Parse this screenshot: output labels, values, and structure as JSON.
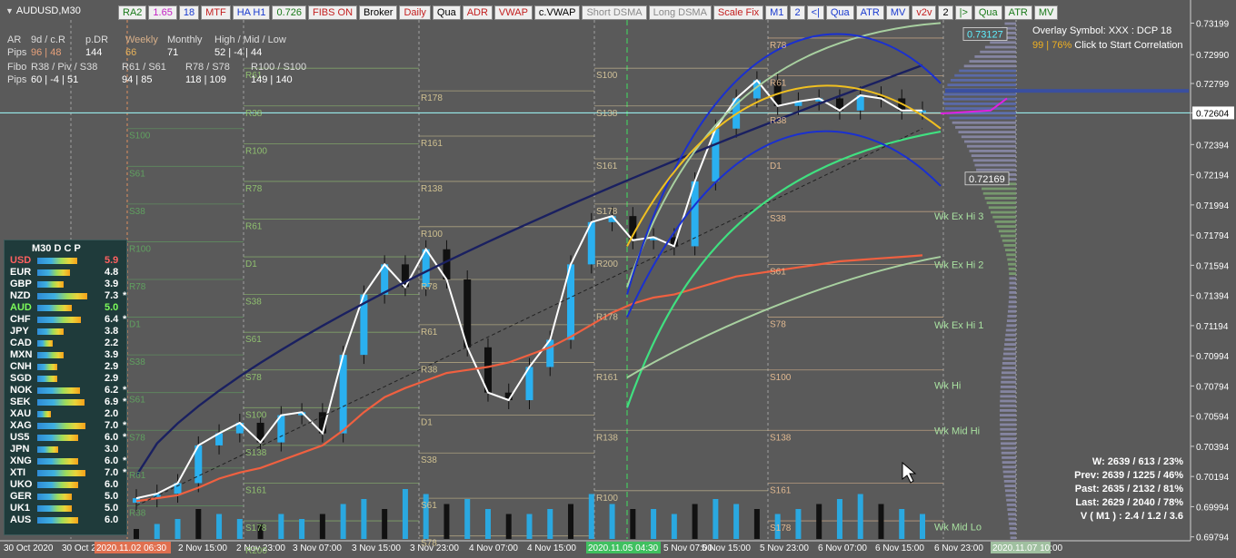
{
  "symbol": "AUDUSD,M30",
  "toolbar": [
    {
      "label": "RA2",
      "color": "#1a7a1a"
    },
    {
      "label": "1.65",
      "color": "#c41fc4"
    },
    {
      "label": "18",
      "color": "#1a3bd0"
    },
    {
      "label": "MTF",
      "color": "#c41f1f"
    },
    {
      "label": "HA H1",
      "color": "#1a3bd0"
    },
    {
      "label": "0.726",
      "color": "#1a7a1a"
    },
    {
      "label": "FIBS ON",
      "color": "#c41f1f"
    },
    {
      "label": "Broker",
      "color": "#000000"
    },
    {
      "label": "Daily",
      "color": "#c41f1f"
    },
    {
      "label": "Qua",
      "color": "#000000"
    },
    {
      "label": "ADR",
      "color": "#c41f1f"
    },
    {
      "label": "VWAP",
      "color": "#c41f1f"
    },
    {
      "label": "c.VWAP",
      "color": "#000000"
    },
    {
      "label": "Short DSMA",
      "color": "#8a8a8a"
    },
    {
      "label": "Long DSMA",
      "color": "#8a8a8a"
    },
    {
      "label": "Scale Fix",
      "color": "#c41f1f"
    },
    {
      "label": "M1",
      "color": "#1a3bd0"
    },
    {
      "label": "2",
      "color": "#1a3bd0"
    },
    {
      "label": "<|",
      "color": "#1a3bd0"
    },
    {
      "label": "Qua",
      "color": "#1a3bd0"
    },
    {
      "label": "ATR",
      "color": "#1a3bd0"
    },
    {
      "label": "MV",
      "color": "#1a3bd0"
    },
    {
      "label": "v2v",
      "color": "#c41f1f"
    },
    {
      "label": "2",
      "color": "#000000"
    },
    {
      "label": "|>",
      "color": "#1a7a1a"
    },
    {
      "label": "Qua",
      "color": "#1a7a1a"
    },
    {
      "label": "ATR",
      "color": "#1a7a1a"
    },
    {
      "label": "MV",
      "color": "#1a7a1a"
    }
  ],
  "info": {
    "row1": [
      "AR",
      "9d / c.R",
      "p.DR",
      "Weekly",
      "Monthly",
      "High / Mid / Low"
    ],
    "row2": [
      "Pips",
      "96 | 48",
      "144",
      "66",
      "71",
      "52 | -4 | 44"
    ],
    "row3": [
      "Fibo",
      "R38 / Piv / S38",
      "R61 / S61",
      "R78 / S78",
      "R100 / S100"
    ],
    "row4": [
      "Pips",
      "60 | -4 | 51",
      "94 | 85",
      "118 | 109",
      "149 | 140"
    ]
  },
  "overlay": {
    "line1": "Overlay Symbol: XXX : DCP 18",
    "line2_pct": "99 | 76%",
    "line2_rest": " Click to Start Correlation"
  },
  "price_boxes": {
    "top": "0.73127",
    "current": "0.72604",
    "mid": "0.72169"
  },
  "strength": {
    "header": "M30   D C P",
    "rows": [
      {
        "name": "USD",
        "value": "5.9",
        "star": "",
        "color": "#ff6060"
      },
      {
        "name": "EUR",
        "value": "4.8",
        "star": "",
        "color": "#ffffff"
      },
      {
        "name": "GBP",
        "value": "3.9",
        "star": "",
        "color": "#ffffff"
      },
      {
        "name": "NZD",
        "value": "7.3",
        "star": "*",
        "color": "#ffffff"
      },
      {
        "name": "AUD",
        "value": "5.0",
        "star": "",
        "color": "#7cfc5a"
      },
      {
        "name": "CHF",
        "value": "6.4",
        "star": "*",
        "color": "#ffffff"
      },
      {
        "name": "JPY",
        "value": "3.8",
        "star": "",
        "color": "#ffffff"
      },
      {
        "name": "CAD",
        "value": "2.2",
        "star": "",
        "color": "#ffffff"
      },
      {
        "name": "MXN",
        "value": "3.9",
        "star": "",
        "color": "#ffffff"
      },
      {
        "name": "CNH",
        "value": "2.9",
        "star": "",
        "color": "#ffffff"
      },
      {
        "name": "SGD",
        "value": "2.9",
        "star": "",
        "color": "#ffffff"
      },
      {
        "name": "NOK",
        "value": "6.2",
        "star": "*",
        "color": "#ffffff"
      },
      {
        "name": "SEK",
        "value": "6.9",
        "star": "*",
        "color": "#ffffff"
      },
      {
        "name": "XAU",
        "value": "2.0",
        "star": "",
        "color": "#ffffff"
      },
      {
        "name": "XAG",
        "value": "7.0",
        "star": "*",
        "color": "#ffffff"
      },
      {
        "name": "US5",
        "value": "6.0",
        "star": "*",
        "color": "#ffffff"
      },
      {
        "name": "JPN",
        "value": "3.0",
        "star": "",
        "color": "#ffffff"
      },
      {
        "name": "XNG",
        "value": "6.0",
        "star": "*",
        "color": "#ffffff"
      },
      {
        "name": "XTI",
        "value": "7.0",
        "star": "*",
        "color": "#ffffff"
      },
      {
        "name": "UKO",
        "value": "6.0",
        "star": "",
        "color": "#ffffff"
      },
      {
        "name": "GER",
        "value": "5.0",
        "star": "",
        "color": "#ffffff"
      },
      {
        "name": "UK1",
        "value": "5.0",
        "star": "",
        "color": "#ffffff"
      },
      {
        "name": "AUS",
        "value": "6.0",
        "star": "",
        "color": "#ffffff"
      }
    ]
  },
  "stats": [
    "W: 2639 / 613 / 23%",
    "Prev: 2639 / 1225 / 46%",
    "Past: 2635 / 2132 / 81%",
    "Last: 2629 / 2040 / 78%",
    "V ( M1 ) : 2.4 / 1.2 / 3.6"
  ],
  "side_labels": [
    "Wk Ex Hi 3",
    "Wk Ex Hi 2",
    "Wk Ex Hi 1",
    "Wk Hi",
    "Wk Mid Hi",
    "Wk Mid Lo"
  ],
  "fib_labels": [
    "R61",
    "R38",
    "R100",
    "R78",
    "R61",
    "D1",
    "S38",
    "S61",
    "S78",
    "S100",
    "S138",
    "S161",
    "S178",
    "R200",
    "R178",
    "R161",
    "R138",
    "R100",
    "R78",
    "R61",
    "R38",
    "D1",
    "S38",
    "S61",
    "S78",
    "S100",
    "S138",
    "S161",
    "S178",
    "R200",
    "R178",
    "R161",
    "R138",
    "R100",
    "R78",
    "R61",
    "R38",
    "D1",
    "S38",
    "S61",
    "S78",
    "S100",
    "S138",
    "S161",
    "S178",
    "S100",
    "S61",
    "S38",
    "R100",
    "R78",
    "D1",
    "S38",
    "S61",
    "S78"
  ],
  "chart_data": {
    "type": "line",
    "symbol": "AUDUSD",
    "timeframe": "M30",
    "y_ticks": [
      "0.73199",
      "0.72990",
      "0.72799",
      "0.72604",
      "0.72394",
      "0.72194",
      "0.71994",
      "0.71794",
      "0.71594",
      "0.71394",
      "0.71194",
      "0.70994",
      "0.70794",
      "0.70594",
      "0.70394",
      "0.70194",
      "0.69994",
      "0.69794"
    ],
    "x_ticks": [
      "30 Oct 2020",
      "30 Oct 2",
      "2020.11.02 06:30",
      "2 Nov 15:00",
      "2 Nov 23:00",
      "3 Nov 07:00",
      "3 Nov 15:00",
      "3 Nov 23:00",
      "4 Nov 07:00",
      "4 Nov 15:00",
      "2020.11.05 04:30",
      "5 Nov 07:00",
      "5 Nov 15:00",
      "5 Nov 23:00",
      "6 Nov 07:00",
      "6 Nov 15:00",
      "6 Nov 23:00",
      "2020.11.07 10:00"
    ],
    "ylim": [
      0.6978,
      0.7322
    ],
    "close": [
      0.7005,
      0.7008,
      0.7015,
      0.704,
      0.7048,
      0.7055,
      0.7042,
      0.706,
      0.7062,
      0.7048,
      0.71,
      0.714,
      0.716,
      0.7145,
      0.717,
      0.715,
      0.7105,
      0.7075,
      0.707,
      0.7092,
      0.711,
      0.716,
      0.7188,
      0.7192,
      0.7176,
      0.7178,
      0.7172,
      0.7215,
      0.725,
      0.727,
      0.7282,
      0.7265,
      0.7268,
      0.727,
      0.7262,
      0.7272,
      0.727,
      0.7262,
      0.7262
    ],
    "bar_times": [
      "2020.11.02 00:00",
      "2020.11.02 02:00",
      "2020.11.02 04:00",
      "2020.11.02 08:00",
      "2020.11.02 12:00",
      "2020.11.02 16:00",
      "2020.11.02 20:00",
      "2020.11.03 00:00",
      "2020.11.03 04:00",
      "2020.11.03 08:00",
      "2020.11.03 12:00",
      "2020.11.03 16:00",
      "2020.11.03 20:00",
      "2020.11.04 00:00",
      "2020.11.04 02:00",
      "2020.11.04 04:00",
      "2020.11.04 08:00",
      "2020.11.04 12:00",
      "2020.11.04 16:00",
      "2020.11.04 20:00",
      "2020.11.05 00:00",
      "2020.11.05 04:00",
      "2020.11.05 08:00",
      "2020.11.05 10:00",
      "2020.11.05 12:00",
      "2020.11.05 14:00",
      "2020.11.05 16:00",
      "2020.11.05 18:00",
      "2020.11.05 20:00",
      "2020.11.05 22:00",
      "2020.11.06 00:00",
      "2020.11.06 02:00",
      "2020.11.06 04:00",
      "2020.11.06 06:00",
      "2020.11.06 08:00",
      "2020.11.06 10:00",
      "2020.11.06 12:00",
      "2020.11.06 14:00",
      "2020.11.06 16:00"
    ],
    "vwap": [
      0.7003,
      0.7005,
      0.7007,
      0.7012,
      0.7018,
      0.7022,
      0.7025,
      0.703,
      0.7035,
      0.704,
      0.705,
      0.7062,
      0.7072,
      0.7078,
      0.7083,
      0.7088,
      0.709,
      0.7092,
      0.7095,
      0.71,
      0.7105,
      0.7112,
      0.712,
      0.7128,
      0.7134,
      0.7138,
      0.714,
      0.7144,
      0.7148,
      0.7152,
      0.7154,
      0.7156,
      0.7158,
      0.716,
      0.7162,
      0.7163,
      0.7164,
      0.7165,
      0.7166
    ],
    "volume": [
      0.2,
      0.3,
      0.4,
      0.6,
      0.5,
      0.4,
      0.3,
      0.5,
      0.4,
      0.5,
      0.7,
      0.8,
      0.6,
      1.0,
      0.9,
      0.7,
      0.8,
      0.6,
      0.5,
      0.5,
      0.6,
      0.7,
      0.9,
      0.7,
      0.6,
      0.6,
      0.5,
      0.7,
      0.8,
      0.7,
      0.6,
      0.5,
      0.6,
      0.7,
      0.8,
      0.9,
      0.7,
      0.6,
      0.5
    ],
    "grid": false
  }
}
